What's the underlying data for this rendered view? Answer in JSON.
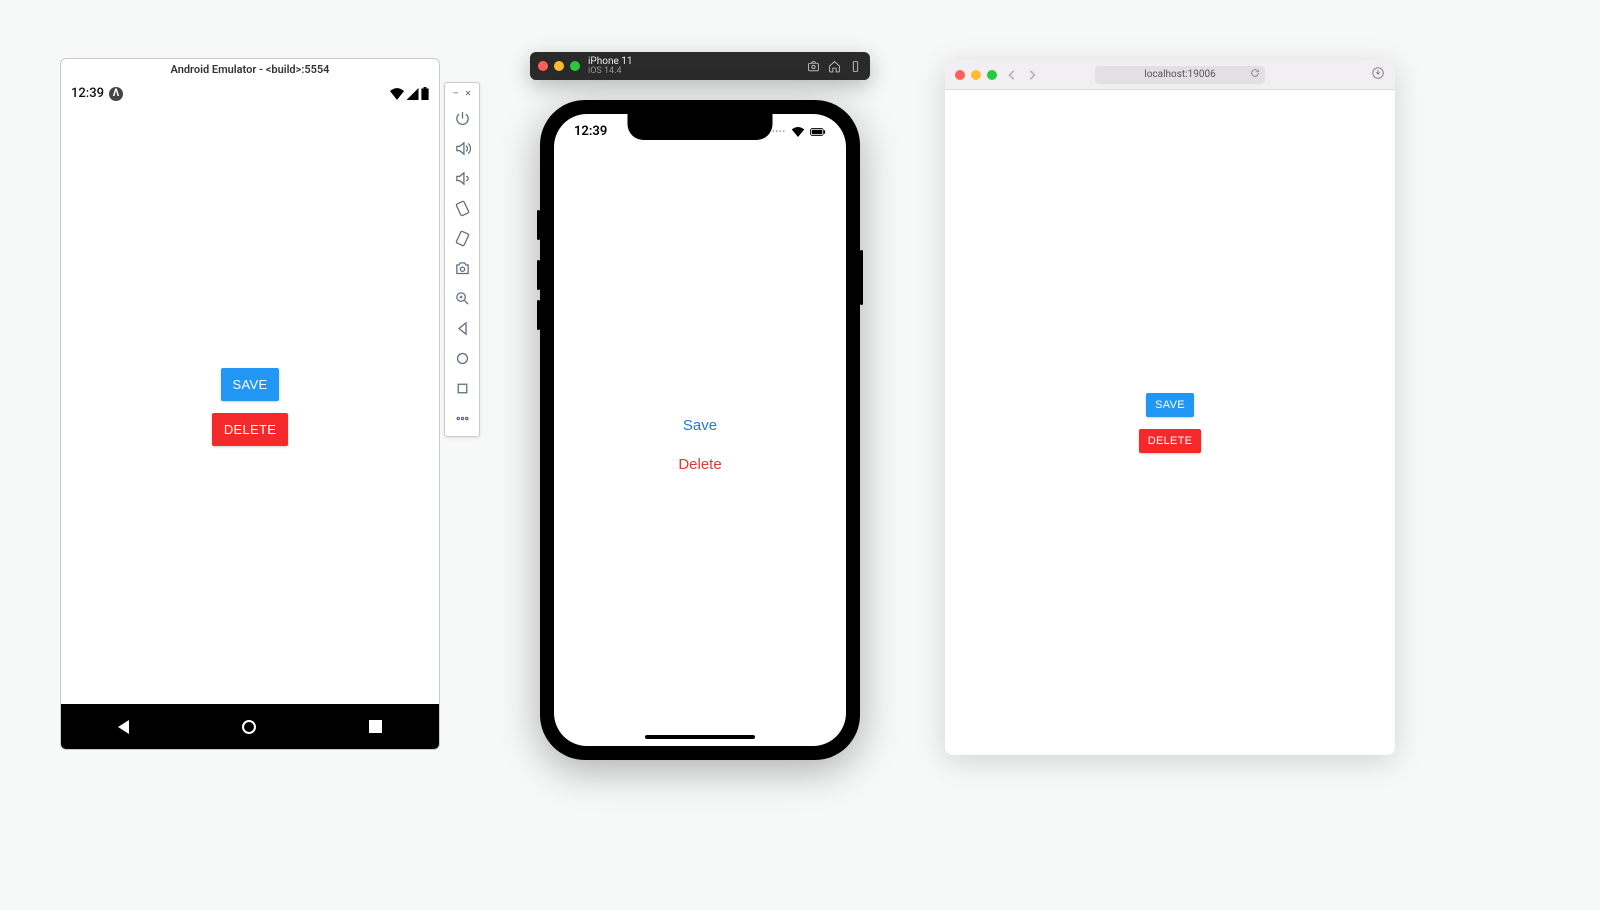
{
  "android": {
    "title": "Android Emulator - <build>:5554",
    "time": "12:39",
    "save_label": "SAVE",
    "delete_label": "DELETE"
  },
  "ios": {
    "titlebar_device": "iPhone 11",
    "titlebar_os": "iOS 14.4",
    "time": "12:39",
    "save_label": "Save",
    "delete_label": "Delete"
  },
  "safari": {
    "url": "localhost:19006",
    "save_label": "SAVE",
    "delete_label": "DELETE"
  },
  "colors": {
    "primary": "#2196f3",
    "danger": "#f4292c"
  }
}
